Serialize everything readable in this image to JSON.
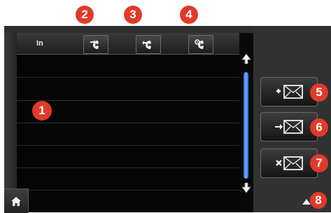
{
  "header": {
    "label": "In"
  },
  "callouts": [
    "1",
    "2",
    "3",
    "4",
    "5",
    "6",
    "7",
    "8"
  ],
  "icons": {
    "header_buttons": [
      "call-in-icon",
      "call-out-icon",
      "call-settings-icon"
    ],
    "message_buttons": [
      "new-message-icon",
      "forward-message-icon",
      "delete-message-icon"
    ],
    "home": "home-icon",
    "scroll_up": "scroll-up-icon",
    "scroll_down": "scroll-down-icon",
    "page_up": "page-up-icon"
  },
  "colors": {
    "callout": "#e03a2a",
    "scrollbar": "#3f8cf0",
    "background": "#232323"
  }
}
